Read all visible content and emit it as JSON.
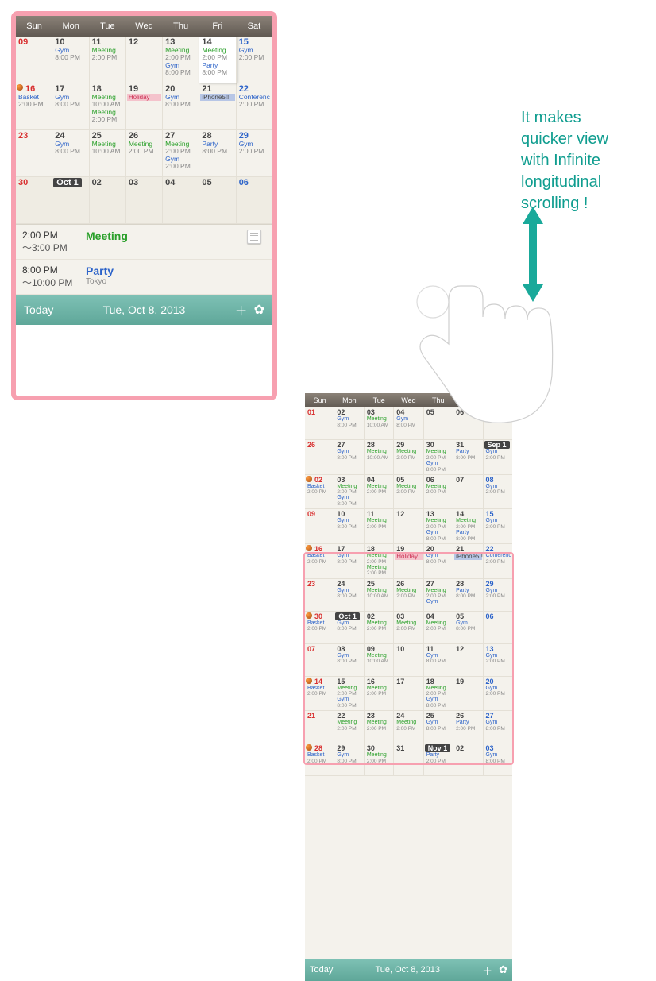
{
  "weekdays": [
    "Sun",
    "Mon",
    "Tue",
    "Wed",
    "Thu",
    "Fri",
    "Sat"
  ],
  "footer": {
    "today": "Today",
    "date": "Tue, Oct 8, 2013"
  },
  "agenda": [
    {
      "time1": "2:00 PM",
      "time2": "～3:00 PM",
      "title": "Meeting",
      "kind": "meeting"
    },
    {
      "time1": "8:00 PM",
      "time2": "～10:00 PM",
      "title": "Party",
      "loc": "Tokyo",
      "kind": "party"
    }
  ],
  "weeks_large": [
    [
      {
        "num": "09",
        "cls": "sun"
      },
      {
        "num": "10",
        "evts": [
          [
            "Gym",
            "gym"
          ],
          [
            "8:00 PM",
            "tm"
          ]
        ]
      },
      {
        "num": "11",
        "evts": [
          [
            "Meeting",
            "meeting"
          ],
          [
            "2:00 PM",
            "tm"
          ]
        ]
      },
      {
        "num": "12"
      },
      {
        "num": "13",
        "evts": [
          [
            "Meeting",
            "meeting"
          ],
          [
            "2:00 PM",
            "tm"
          ],
          [
            "Gym",
            "gym"
          ],
          [
            "8:00 PM",
            "tm"
          ]
        ]
      },
      {
        "num": "14",
        "today": true,
        "evts": [
          [
            "Meeting",
            "meeting"
          ],
          [
            "2:00 PM",
            "tm"
          ],
          [
            "Party",
            "party"
          ],
          [
            "8:00 PM",
            "tm"
          ]
        ]
      },
      {
        "num": "15",
        "cls": "sat",
        "evts": [
          [
            "Gym",
            "gym"
          ],
          [
            "2:00 PM",
            "tm"
          ]
        ]
      }
    ],
    [
      {
        "num": "16",
        "cls": "sun",
        "ball": true,
        "evts": [
          [
            "Basket",
            "basket"
          ],
          [
            "2:00 PM",
            "tm"
          ]
        ]
      },
      {
        "num": "17",
        "evts": [
          [
            "Gym",
            "gym"
          ],
          [
            "8:00 PM",
            "tm"
          ]
        ]
      },
      {
        "num": "18",
        "evts": [
          [
            "Meeting",
            "meeting"
          ],
          [
            "10:00 AM",
            "tm"
          ],
          [
            "Meeting",
            "meeting"
          ],
          [
            "2:00 PM",
            "tm"
          ]
        ]
      },
      {
        "num": "19",
        "holiday": "Holiday"
      },
      {
        "num": "20",
        "evts": [
          [
            "Gym",
            "gym"
          ],
          [
            "8:00 PM",
            "tm"
          ]
        ]
      },
      {
        "num": "21",
        "iphone5": "iPhone5!!"
      },
      {
        "num": "22",
        "cls": "sat",
        "evts": [
          [
            "Conferenc",
            "conf"
          ],
          [
            "2:00 PM",
            "tm"
          ]
        ]
      }
    ],
    [
      {
        "num": "23",
        "cls": "sun"
      },
      {
        "num": "24",
        "evts": [
          [
            "Gym",
            "gym"
          ],
          [
            "8:00 PM",
            "tm"
          ]
        ]
      },
      {
        "num": "25",
        "evts": [
          [
            "Meeting",
            "meeting"
          ],
          [
            "10:00 AM",
            "tm"
          ]
        ]
      },
      {
        "num": "26",
        "evts": [
          [
            "Meeting",
            "meeting"
          ],
          [
            "2:00 PM",
            "tm"
          ]
        ]
      },
      {
        "num": "27",
        "evts": [
          [
            "Meeting",
            "meeting"
          ],
          [
            "2:00 PM",
            "tm"
          ],
          [
            "Gym",
            "gym"
          ],
          [
            "2:00 PM",
            "tm"
          ]
        ]
      },
      {
        "num": "28",
        "evts": [
          [
            "Party",
            "party"
          ],
          [
            "8:00 PM",
            "tm"
          ]
        ]
      },
      {
        "num": "29",
        "cls": "sat",
        "evts": [
          [
            "Gym",
            "gym"
          ],
          [
            "2:00 PM",
            "tm"
          ]
        ]
      }
    ],
    [
      {
        "num": "30",
        "cls": "sun"
      },
      {
        "num": "Oct 1",
        "cls": "month-start"
      },
      {
        "num": "02"
      },
      {
        "num": "03"
      },
      {
        "num": "04"
      },
      {
        "num": "05"
      },
      {
        "num": "06",
        "cls": "sat"
      }
    ]
  ],
  "weeks_small": [
    [
      {
        "num": "01",
        "cls": "sun"
      },
      {
        "num": "02",
        "evts": [
          [
            "Gym",
            "gym"
          ],
          [
            "8:00 PM",
            "tm"
          ]
        ]
      },
      {
        "num": "03",
        "evts": [
          [
            "Meeting",
            "meeting"
          ],
          [
            "10:00 AM",
            "tm"
          ]
        ]
      },
      {
        "num": "04",
        "evts": [
          [
            "Gym",
            "gym"
          ],
          [
            "8:00 PM",
            "tm"
          ]
        ]
      },
      {
        "num": "05"
      },
      {
        "num": "06"
      },
      {
        "num": "07",
        "cls": "sat"
      }
    ],
    [
      {
        "num": "26",
        "cls": "sun"
      },
      {
        "num": "27",
        "evts": [
          [
            "Gym",
            "gym"
          ],
          [
            "8:00 PM",
            "tm"
          ]
        ]
      },
      {
        "num": "28",
        "evts": [
          [
            "Meeting",
            "meeting"
          ],
          [
            "10:00 AM",
            "tm"
          ]
        ]
      },
      {
        "num": "29",
        "evts": [
          [
            "Meeting",
            "meeting"
          ],
          [
            "2:00 PM",
            "tm"
          ]
        ]
      },
      {
        "num": "30",
        "evts": [
          [
            "Meeting",
            "meeting"
          ],
          [
            "2:00 PM",
            "tm"
          ],
          [
            "Gym",
            "gym"
          ],
          [
            "8:00 PM",
            "tm"
          ]
        ]
      },
      {
        "num": "31",
        "evts": [
          [
            "Party",
            "party"
          ],
          [
            "8:00 PM",
            "tm"
          ]
        ]
      },
      {
        "num": "Sep 1",
        "cls": "sat month-start",
        "evts": [
          [
            "Gym",
            "gym"
          ],
          [
            "2:00 PM",
            "tm"
          ]
        ]
      }
    ],
    [
      {
        "num": "02",
        "cls": "sun",
        "ball": true,
        "evts": [
          [
            "Basket",
            "basket"
          ],
          [
            "2:00 PM",
            "tm"
          ]
        ]
      },
      {
        "num": "03",
        "evts": [
          [
            "Meeting",
            "meeting"
          ],
          [
            "2:00 PM",
            "tm"
          ],
          [
            "Gym",
            "gym"
          ],
          [
            "8:00 PM",
            "tm"
          ]
        ]
      },
      {
        "num": "04",
        "evts": [
          [
            "Meeting",
            "meeting"
          ],
          [
            "2:00 PM",
            "tm"
          ]
        ]
      },
      {
        "num": "05",
        "evts": [
          [
            "Meeting",
            "meeting"
          ],
          [
            "2:00 PM",
            "tm"
          ]
        ]
      },
      {
        "num": "06",
        "evts": [
          [
            "Meeting",
            "meeting"
          ],
          [
            "2:00 PM",
            "tm"
          ]
        ]
      },
      {
        "num": "07"
      },
      {
        "num": "08",
        "cls": "sat",
        "evts": [
          [
            "Gym",
            "gym"
          ],
          [
            "2:00 PM",
            "tm"
          ]
        ]
      }
    ],
    [
      {
        "num": "09",
        "cls": "sun"
      },
      {
        "num": "10",
        "evts": [
          [
            "Gym",
            "gym"
          ],
          [
            "8:00 PM",
            "tm"
          ]
        ]
      },
      {
        "num": "11",
        "evts": [
          [
            "Meeting",
            "meeting"
          ],
          [
            "2:00 PM",
            "tm"
          ]
        ]
      },
      {
        "num": "12"
      },
      {
        "num": "13",
        "evts": [
          [
            "Meeting",
            "meeting"
          ],
          [
            "2:00 PM",
            "tm"
          ],
          [
            "Gym",
            "gym"
          ],
          [
            "8:00 PM",
            "tm"
          ]
        ]
      },
      {
        "num": "14",
        "evts": [
          [
            "Meeting",
            "meeting"
          ],
          [
            "2:00 PM",
            "tm"
          ],
          [
            "Party",
            "party"
          ],
          [
            "8:00 PM",
            "tm"
          ]
        ]
      },
      {
        "num": "15",
        "cls": "sat",
        "evts": [
          [
            "Gym",
            "gym"
          ],
          [
            "2:00 PM",
            "tm"
          ]
        ]
      }
    ],
    [
      {
        "num": "16",
        "cls": "sun",
        "ball": true,
        "evts": [
          [
            "Basket",
            "basket"
          ],
          [
            "2:00 PM",
            "tm"
          ]
        ]
      },
      {
        "num": "17",
        "evts": [
          [
            "Gym",
            "gym"
          ],
          [
            "8:00 PM",
            "tm"
          ]
        ]
      },
      {
        "num": "18",
        "evts": [
          [
            "Meeting",
            "meeting"
          ],
          [
            "2:00 PM",
            "tm"
          ],
          [
            "Meeting",
            "meeting"
          ],
          [
            "2:00 PM",
            "tm"
          ]
        ]
      },
      {
        "num": "19",
        "holiday": "Holiday"
      },
      {
        "num": "20",
        "evts": [
          [
            "Gym",
            "gym"
          ],
          [
            "8:00 PM",
            "tm"
          ]
        ]
      },
      {
        "num": "21",
        "iphone5": "iPhone5!!"
      },
      {
        "num": "22",
        "cls": "sat",
        "evts": [
          [
            "Conferenc",
            "conf"
          ],
          [
            "2:00 PM",
            "tm"
          ]
        ]
      }
    ],
    [
      {
        "num": "23",
        "cls": "sun"
      },
      {
        "num": "24",
        "evts": [
          [
            "Gym",
            "gym"
          ],
          [
            "8:00 PM",
            "tm"
          ]
        ]
      },
      {
        "num": "25",
        "evts": [
          [
            "Meeting",
            "meeting"
          ],
          [
            "10:00 AM",
            "tm"
          ]
        ]
      },
      {
        "num": "26",
        "evts": [
          [
            "Meeting",
            "meeting"
          ],
          [
            "2:00 PM",
            "tm"
          ]
        ]
      },
      {
        "num": "27",
        "evts": [
          [
            "Meeting",
            "meeting"
          ],
          [
            "2:00 PM",
            "tm"
          ],
          [
            "Gym",
            "gym"
          ]
        ]
      },
      {
        "num": "28",
        "evts": [
          [
            "Party",
            "party"
          ],
          [
            "8:00 PM",
            "tm"
          ]
        ]
      },
      {
        "num": "29",
        "cls": "sat",
        "evts": [
          [
            "Gym",
            "gym"
          ],
          [
            "2:00 PM",
            "tm"
          ]
        ]
      }
    ],
    [
      {
        "num": "30",
        "cls": "sun",
        "ball": true,
        "evts": [
          [
            "Basket",
            "basket"
          ],
          [
            "2:00 PM",
            "tm"
          ]
        ]
      },
      {
        "num": "Oct 1",
        "cls": "month-start",
        "evts": [
          [
            "Gym",
            "gym"
          ],
          [
            "8:00 PM",
            "tm"
          ]
        ]
      },
      {
        "num": "02",
        "evts": [
          [
            "Meeting",
            "meeting"
          ],
          [
            "2:00 PM",
            "tm"
          ]
        ]
      },
      {
        "num": "03",
        "evts": [
          [
            "Meeting",
            "meeting"
          ],
          [
            "2:00 PM",
            "tm"
          ]
        ]
      },
      {
        "num": "04",
        "evts": [
          [
            "Meeting",
            "meeting"
          ],
          [
            "2:00 PM",
            "tm"
          ]
        ]
      },
      {
        "num": "05",
        "evts": [
          [
            "Gym",
            "gym"
          ],
          [
            "8:00 PM",
            "tm"
          ]
        ]
      },
      {
        "num": "06",
        "cls": "sat"
      }
    ],
    [
      {
        "num": "07",
        "cls": "sun"
      },
      {
        "num": "08",
        "evts": [
          [
            "Gym",
            "gym"
          ],
          [
            "8:00 PM",
            "tm"
          ]
        ]
      },
      {
        "num": "09",
        "evts": [
          [
            "Meeting",
            "meeting"
          ],
          [
            "10:00 AM",
            "tm"
          ]
        ]
      },
      {
        "num": "10"
      },
      {
        "num": "11",
        "evts": [
          [
            "Gym",
            "gym"
          ],
          [
            "8:00 PM",
            "tm"
          ]
        ]
      },
      {
        "num": "12"
      },
      {
        "num": "13",
        "cls": "sat",
        "evts": [
          [
            "Gym",
            "gym"
          ],
          [
            "2:00 PM",
            "tm"
          ]
        ]
      }
    ],
    [
      {
        "num": "14",
        "cls": "sun",
        "ball": true,
        "evts": [
          [
            "Basket",
            "basket"
          ],
          [
            "2:00 PM",
            "tm"
          ]
        ]
      },
      {
        "num": "15",
        "evts": [
          [
            "Meeting",
            "meeting"
          ],
          [
            "2:00 PM",
            "tm"
          ],
          [
            "Gym",
            "gym"
          ],
          [
            "8:00 PM",
            "tm"
          ]
        ]
      },
      {
        "num": "16",
        "evts": [
          [
            "Meeting",
            "meeting"
          ],
          [
            "2:00 PM",
            "tm"
          ]
        ]
      },
      {
        "num": "17"
      },
      {
        "num": "18",
        "evts": [
          [
            "Meeting",
            "meeting"
          ],
          [
            "2:00 PM",
            "tm"
          ],
          [
            "Gym",
            "gym"
          ],
          [
            "8:00 PM",
            "tm"
          ]
        ]
      },
      {
        "num": "19"
      },
      {
        "num": "20",
        "cls": "sat",
        "evts": [
          [
            "Gym",
            "gym"
          ],
          [
            "2:00 PM",
            "tm"
          ]
        ]
      }
    ],
    [
      {
        "num": "21",
        "cls": "sun"
      },
      {
        "num": "22",
        "evts": [
          [
            "Meeting",
            "meeting"
          ],
          [
            "2:00 PM",
            "tm"
          ]
        ]
      },
      {
        "num": "23",
        "evts": [
          [
            "Meeting",
            "meeting"
          ],
          [
            "2:00 PM",
            "tm"
          ]
        ]
      },
      {
        "num": "24",
        "evts": [
          [
            "Meeting",
            "meeting"
          ],
          [
            "2:00 PM",
            "tm"
          ]
        ]
      },
      {
        "num": "25",
        "evts": [
          [
            "Gym",
            "gym"
          ],
          [
            "8:00 PM",
            "tm"
          ]
        ]
      },
      {
        "num": "26",
        "evts": [
          [
            "Party",
            "party"
          ],
          [
            "2:00 PM",
            "tm"
          ]
        ]
      },
      {
        "num": "27",
        "cls": "sat",
        "evts": [
          [
            "Gym",
            "gym"
          ],
          [
            "8:00 PM",
            "tm"
          ]
        ]
      }
    ],
    [
      {
        "num": "28",
        "cls": "sun",
        "ball": true,
        "evts": [
          [
            "Basket",
            "basket"
          ],
          [
            "2:00 PM",
            "tm"
          ]
        ]
      },
      {
        "num": "29",
        "evts": [
          [
            "Gym",
            "gym"
          ],
          [
            "8:00 PM",
            "tm"
          ]
        ]
      },
      {
        "num": "30",
        "evts": [
          [
            "Meeting",
            "meeting"
          ],
          [
            "2:00 PM",
            "tm"
          ]
        ]
      },
      {
        "num": "31"
      },
      {
        "num": "Nov 1",
        "cls": "month-start",
        "evts": [
          [
            "Party",
            "party"
          ],
          [
            "2:00 PM",
            "tm"
          ]
        ]
      },
      {
        "num": "02"
      },
      {
        "num": "03",
        "cls": "sat",
        "evts": [
          [
            "Gym",
            "gym"
          ],
          [
            "8:00 PM",
            "tm"
          ]
        ]
      }
    ]
  ],
  "callout": {
    "l1": "It makes",
    "l2": "quicker view",
    "l3": "with Infinite",
    "l4": "longitudinal",
    "l5": "scrolling !"
  }
}
